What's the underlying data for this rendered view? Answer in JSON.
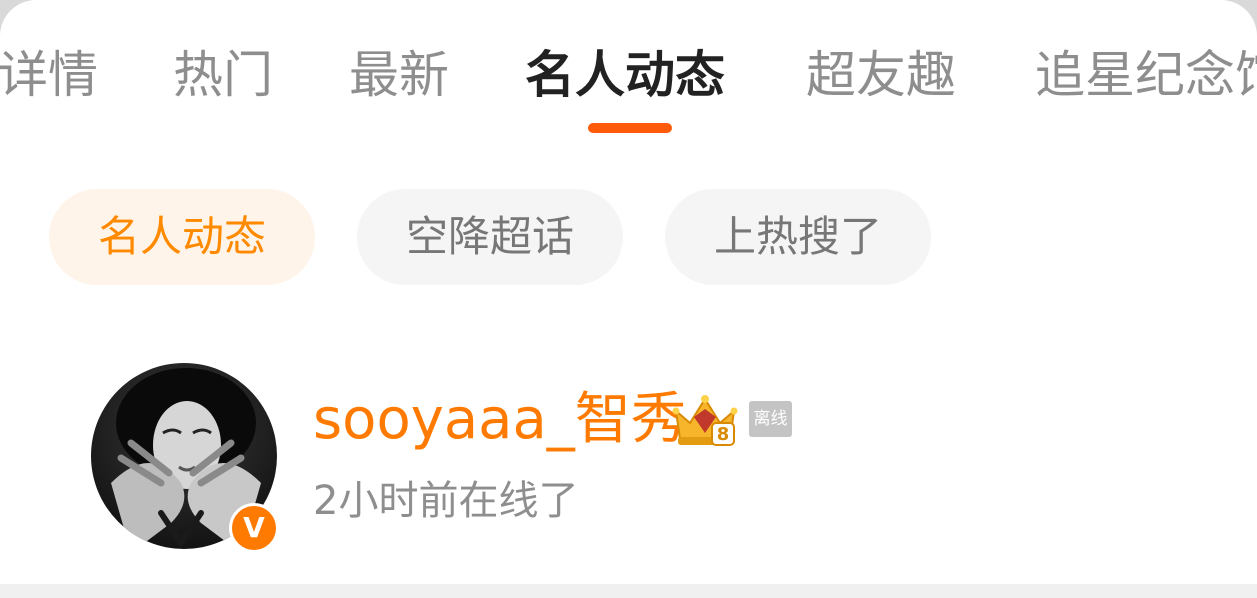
{
  "tabs": [
    {
      "label": "详情"
    },
    {
      "label": "热门"
    },
    {
      "label": "最新"
    },
    {
      "label": "名人动态",
      "active": true
    },
    {
      "label": "超友趣"
    },
    {
      "label": "追星纪念馆"
    }
  ],
  "chips": [
    {
      "label": "名人动态",
      "active": true
    },
    {
      "label": "空降超话"
    },
    {
      "label": "上热搜了"
    }
  ],
  "user": {
    "name": "sooyaaa_智秀",
    "status_badge": "离线",
    "last_online": "2小时前在线了",
    "level_badge": "8",
    "verified_badge": "V",
    "avatar_icon": "avatar-photo",
    "crown_icon": "crown-level-icon"
  },
  "colors": {
    "accent": "#ff7a00",
    "tab_indicator": "#ff5a0a",
    "chip_active_bg": "#fff4ea",
    "chip_bg": "#f5f5f5"
  }
}
